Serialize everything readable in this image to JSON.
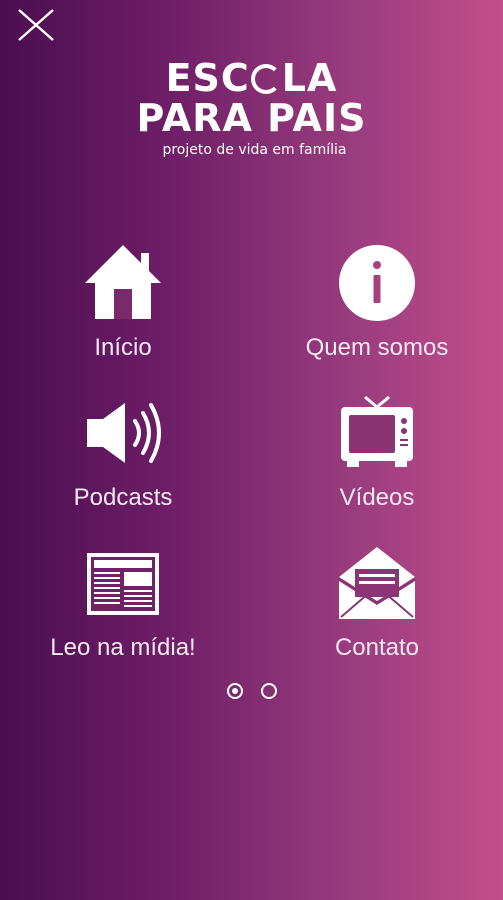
{
  "header": {
    "close_icon": "close-icon"
  },
  "logo": {
    "line1_a": "ESC",
    "line1_b": "LA",
    "line2": "PARA PAIS",
    "subtitle": "projeto de vida em família"
  },
  "menu": {
    "items": [
      {
        "label": "Início",
        "icon": "home-icon"
      },
      {
        "label": "Quem somos",
        "icon": "info-icon"
      },
      {
        "label": "Podcasts",
        "icon": "speaker-icon"
      },
      {
        "label": "Vídeos",
        "icon": "tv-icon"
      },
      {
        "label": "Leo na mídia!",
        "icon": "newspaper-icon"
      },
      {
        "label": "Contato",
        "icon": "mail-icon"
      }
    ]
  },
  "pagination": {
    "pages": 2,
    "current": 1
  },
  "colors": {
    "gradient_start": "#4b0d50",
    "gradient_end": "#c24f8c",
    "foreground": "#ffffff"
  }
}
